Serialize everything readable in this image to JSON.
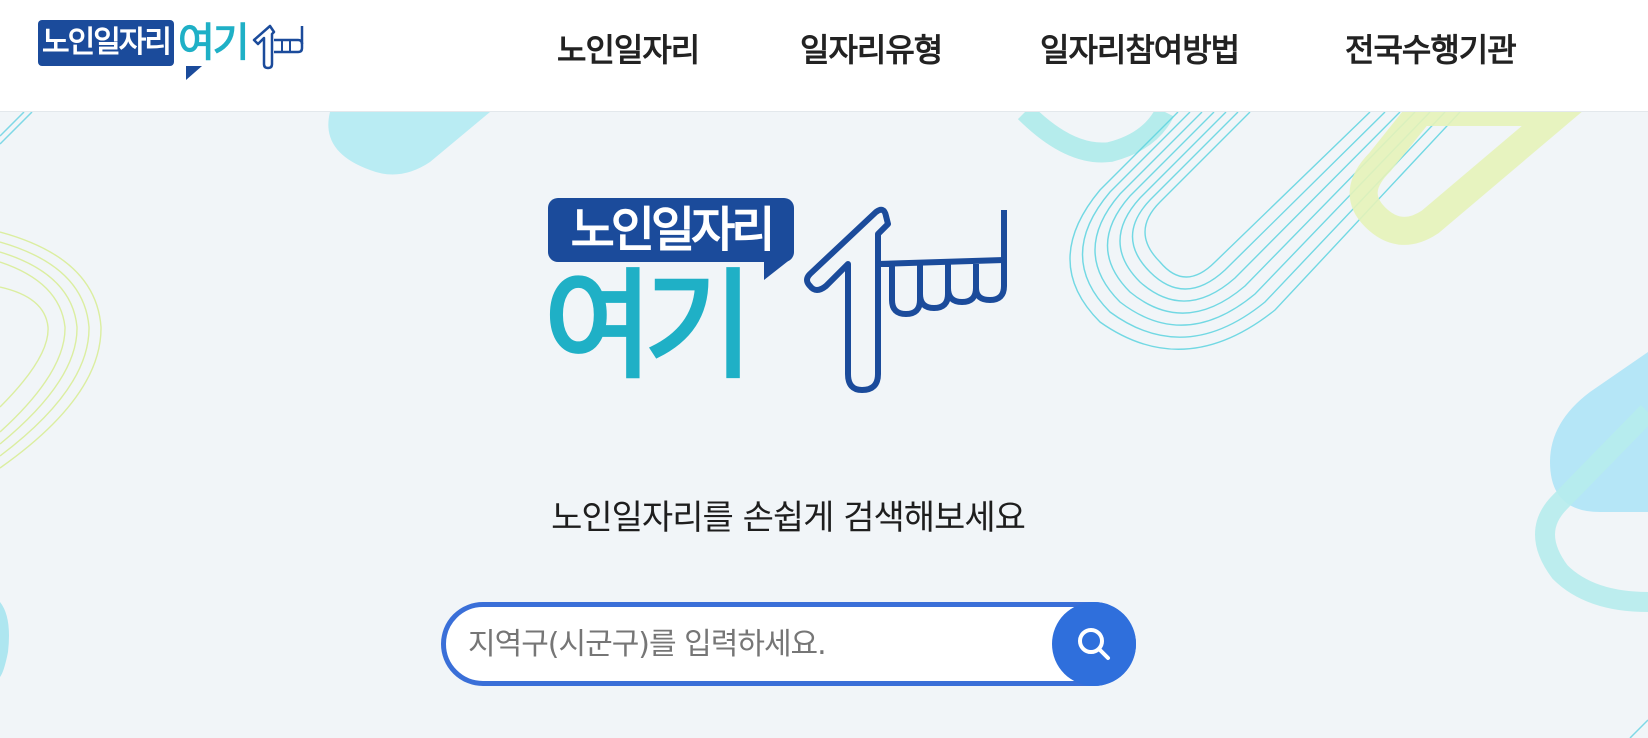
{
  "brand": {
    "box_text": "노인일자리",
    "here_text": "여기"
  },
  "nav": {
    "items": [
      {
        "label": "노인일자리"
      },
      {
        "label": "일자리유형"
      },
      {
        "label": "일자리참여방법"
      },
      {
        "label": "전국수행기관"
      }
    ]
  },
  "hero": {
    "logo": {
      "box_text": "노인일자리",
      "here_text": "여기"
    },
    "tagline": "노인일자리를 손쉽게 검색해보세요",
    "search": {
      "placeholder": "지역구(시군구)를 입력하세요.",
      "value": "",
      "button_icon": "search-icon"
    }
  },
  "colors": {
    "brand_navy": "#1b4b9b",
    "brand_teal": "#1fb0c6",
    "accent_blue": "#2f6fdc"
  }
}
